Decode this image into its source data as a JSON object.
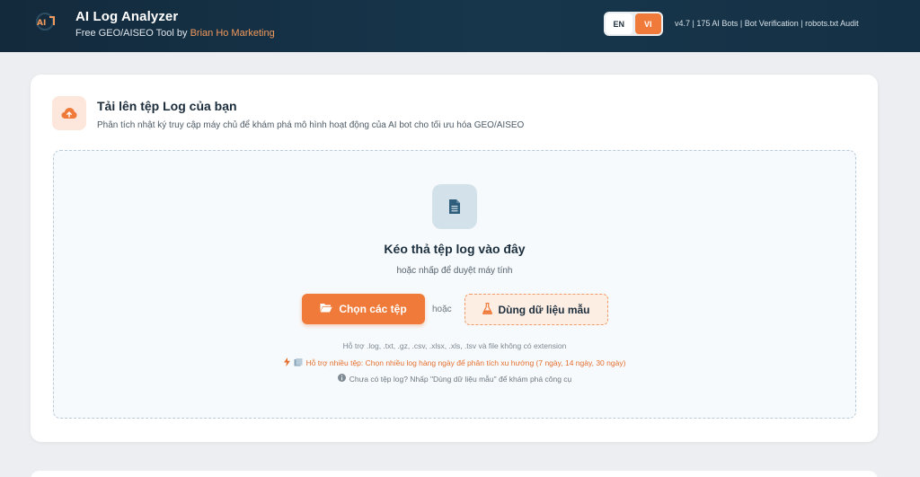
{
  "header": {
    "title": "AI Log Analyzer",
    "subtitle_prefix": "Free GEO/AISEO Tool by ",
    "subtitle_brand": "Brian Ho Marketing",
    "lang_en": "EN",
    "lang_vi": "VI",
    "version_info": "v4.7 | 175 AI Bots | Bot Verification | robots.txt Audit"
  },
  "upload": {
    "title": "Tải lên tệp Log của bạn",
    "description": "Phân tích nhật ký truy cập máy chủ để khám phá mô hình hoạt động của AI bot cho tối ưu hóa GEO/AISEO",
    "drop_title": "Kéo thả tệp log vào đây",
    "drop_subtitle": "hoặc nhấp để duyệt máy tính",
    "choose_button": "Chọn các tệp",
    "or_text": "hoặc",
    "sample_button": "Dùng dữ liệu mẫu",
    "supported_formats": "Hỗ trợ .log, .txt, .gz, .csv, .xlsx, .xls, .tsv và file không có extension",
    "multi_file_hint": "Hỗ trợ nhiều tệp: Chọn nhiều log hàng ngày để phân tích xu hướng (7 ngày, 14 ngày, 30 ngày)",
    "no_log_hint": "Chưa có tệp log? Nhấp \"Dùng dữ liệu mẫu\" để khám phá công cụ"
  },
  "colors": {
    "accent": "#ef7a3a",
    "header_bg": "#17364c",
    "icon_blue": "#2f5d7c"
  },
  "icons": {
    "logo": "ai-logo-icon",
    "upload": "cloud-upload-icon",
    "file": "file-document-icon",
    "folder": "folder-open-icon",
    "flask": "flask-icon",
    "bolt": "bolt-icon",
    "files": "files-icon",
    "info": "info-circle-icon"
  }
}
